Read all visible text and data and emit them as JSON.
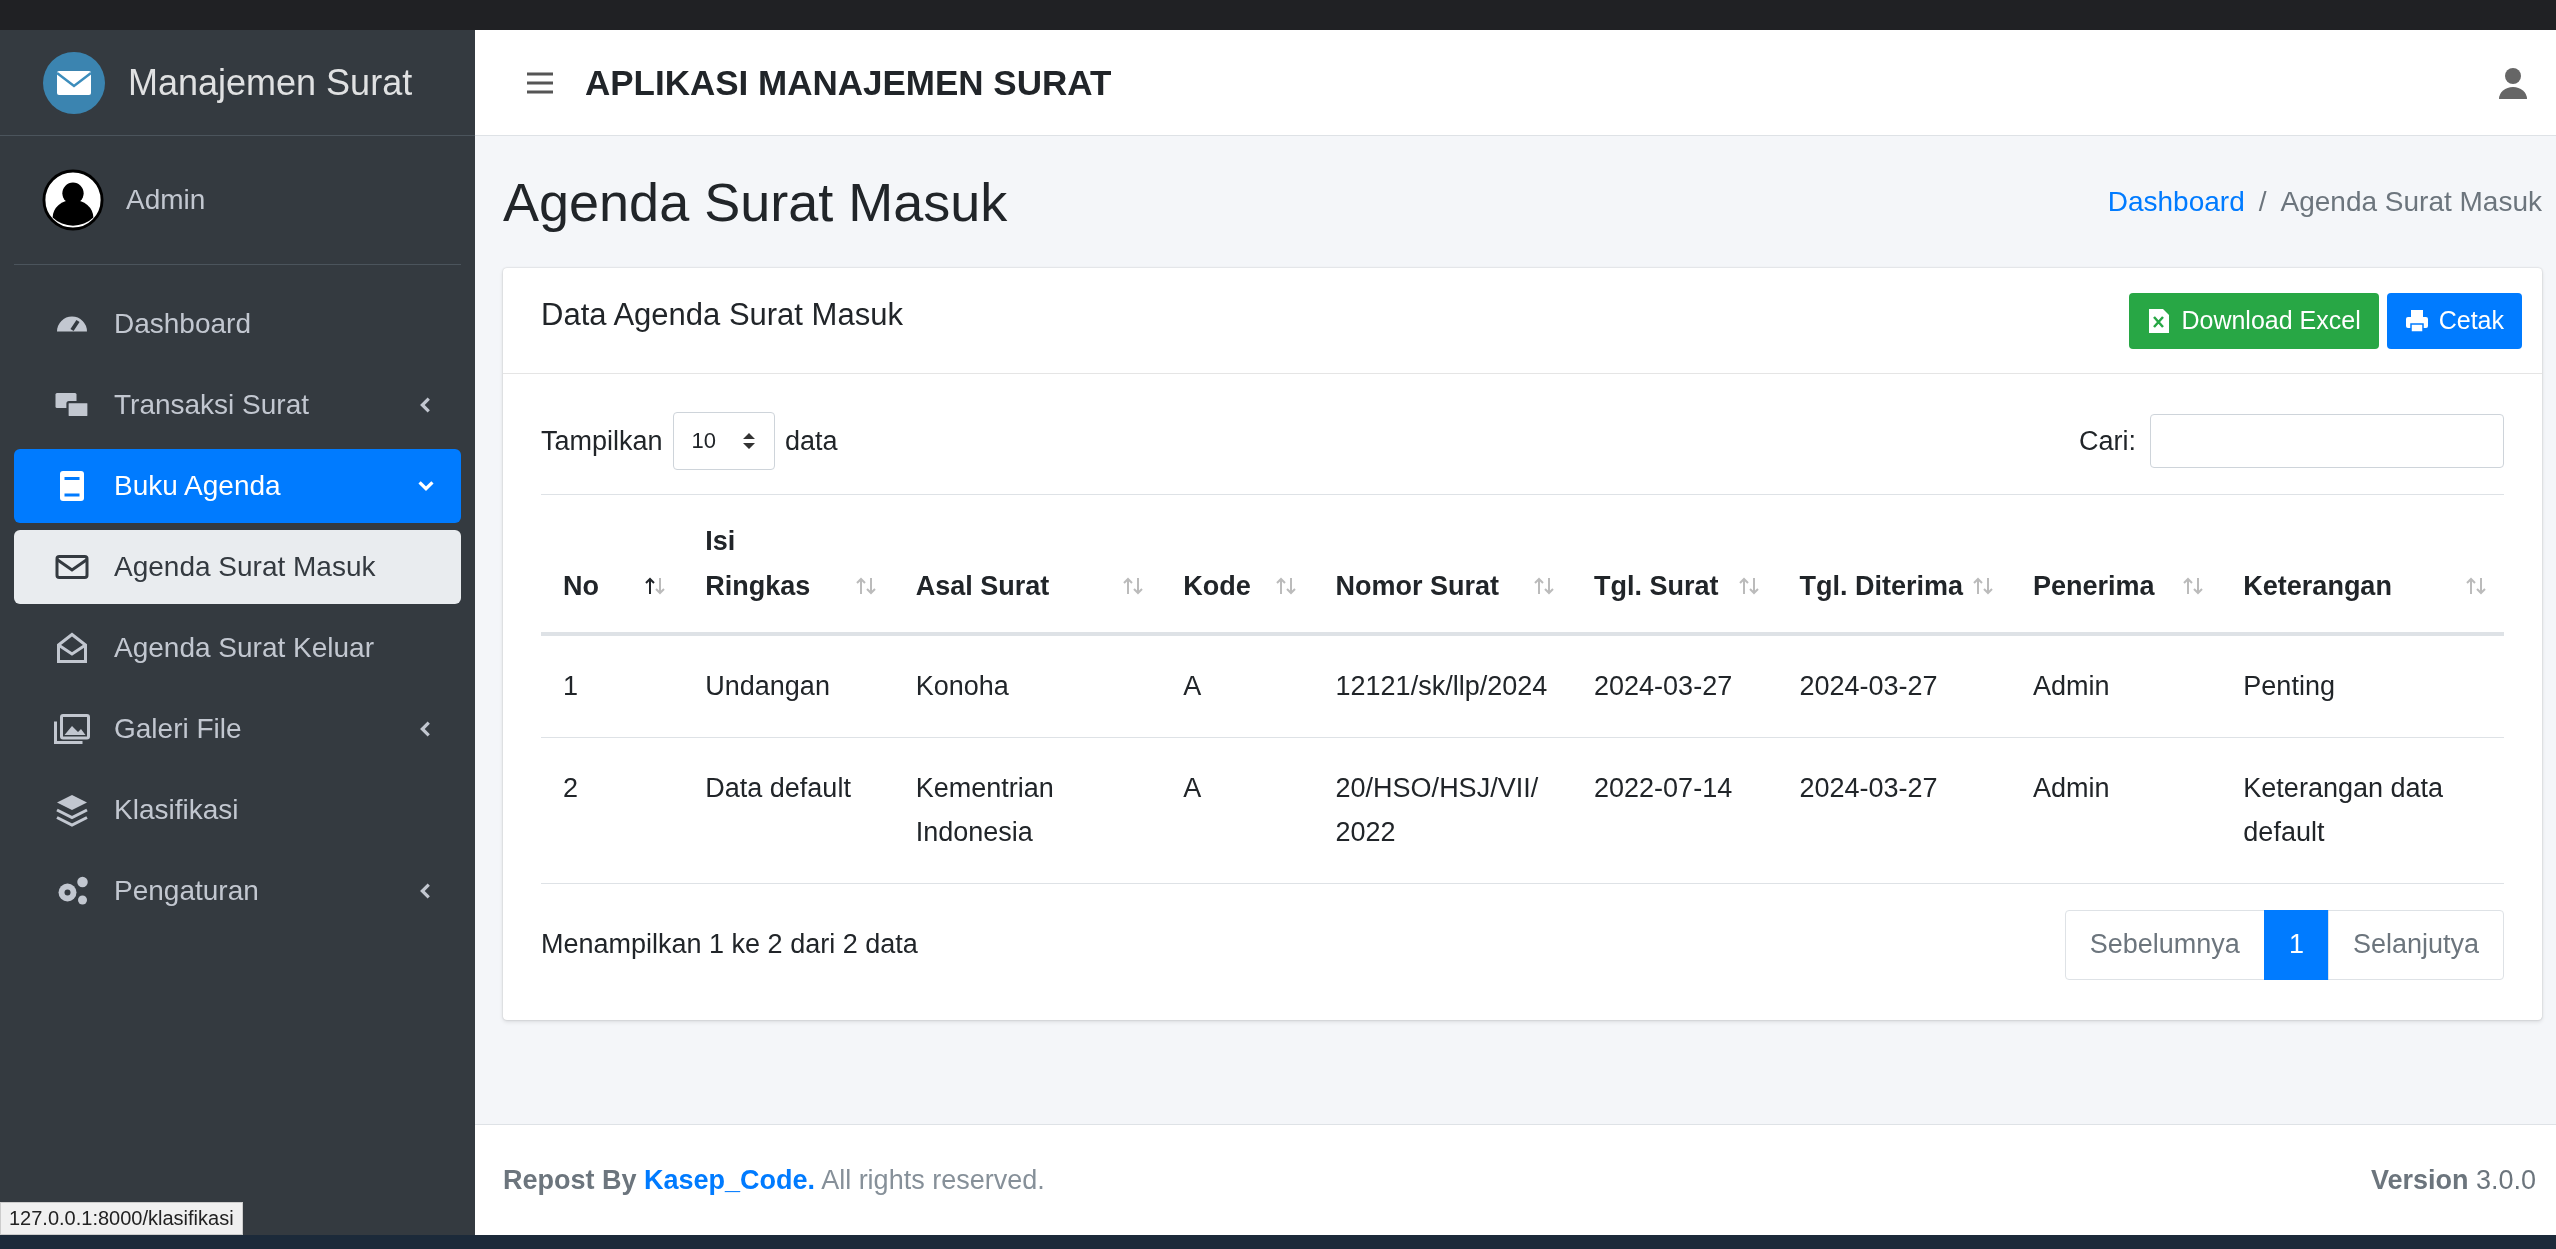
{
  "sidebar": {
    "brand": "Manajemen Surat",
    "user": "Admin",
    "items": [
      {
        "label": "Dashboard",
        "has_submenu": false,
        "expanded": false,
        "selected": false
      },
      {
        "label": "Transaksi Surat",
        "has_submenu": true,
        "expanded": false,
        "selected": false
      },
      {
        "label": "Buku Agenda",
        "has_submenu": true,
        "expanded": true,
        "selected": false
      },
      {
        "label": "Agenda Surat Masuk",
        "has_submenu": false,
        "expanded": false,
        "selected": true
      },
      {
        "label": "Agenda Surat Keluar",
        "has_submenu": false,
        "expanded": false,
        "selected": false
      },
      {
        "label": "Galeri File",
        "has_submenu": true,
        "expanded": false,
        "selected": false
      },
      {
        "label": "Klasifikasi",
        "has_submenu": false,
        "expanded": false,
        "selected": false
      },
      {
        "label": "Pengaturan",
        "has_submenu": true,
        "expanded": false,
        "selected": false
      }
    ]
  },
  "navbar": {
    "title": "APLIKASI MANAJEMEN SURAT"
  },
  "page": {
    "title": "Agenda Surat Masuk",
    "breadcrumb": [
      {
        "label": "Dashboard",
        "kind": "link"
      },
      {
        "label": "/",
        "kind": "separator"
      },
      {
        "label": "Agenda Surat Masuk",
        "kind": "current"
      }
    ]
  },
  "card": {
    "title": "Data Agenda Surat Masuk",
    "buttons": [
      {
        "label": "Download Excel",
        "kind": "excel"
      },
      {
        "label": "Cetak",
        "kind": "print"
      }
    ],
    "length": {
      "prefix": "Tampilkan",
      "value": "10",
      "suffix": "data"
    },
    "search": {
      "label": "Cari:"
    },
    "table": {
      "columns": [
        {
          "label": "No",
          "sorted": true
        },
        {
          "label": "Isi Ringkas",
          "sorted": false
        },
        {
          "label": "Asal Surat",
          "sorted": false
        },
        {
          "label": "Kode",
          "sorted": false
        },
        {
          "label": "Nomor Surat",
          "sorted": false
        },
        {
          "label": "Tgl. Surat",
          "sorted": false
        },
        {
          "label": "Tgl. Diterima",
          "sorted": false
        },
        {
          "label": "Penerima",
          "sorted": false
        },
        {
          "label": "Keterangan",
          "sorted": false
        }
      ],
      "rows": [
        [
          "1",
          "Undangan",
          "Konoha",
          "A",
          "12121/sk/llp/2024",
          "2024-03-27",
          "2024-03-27",
          "Admin",
          "Penting"
        ],
        [
          "2",
          "Data default",
          "Kementrian Indonesia",
          "A",
          "20/HSO/HSJ/VII/2022",
          "2022-07-14",
          "2024-03-27",
          "Admin",
          "Keterangan data default"
        ]
      ]
    },
    "info": "Menampilkan 1 ke 2 dari 2 data",
    "pagination": [
      {
        "label": "Sebelumnya",
        "selected": false
      },
      {
        "label": "1",
        "selected": true
      },
      {
        "label": "Selanjutya",
        "selected": false
      }
    ]
  },
  "footer": {
    "prefix": "Repost By",
    "link": "Kasep_Code.",
    "suffix": "All rights reserved.",
    "version": "**Version** 3.0.0"
  },
  "status_url": "127.0.0.1:8000/klasifikasi"
}
